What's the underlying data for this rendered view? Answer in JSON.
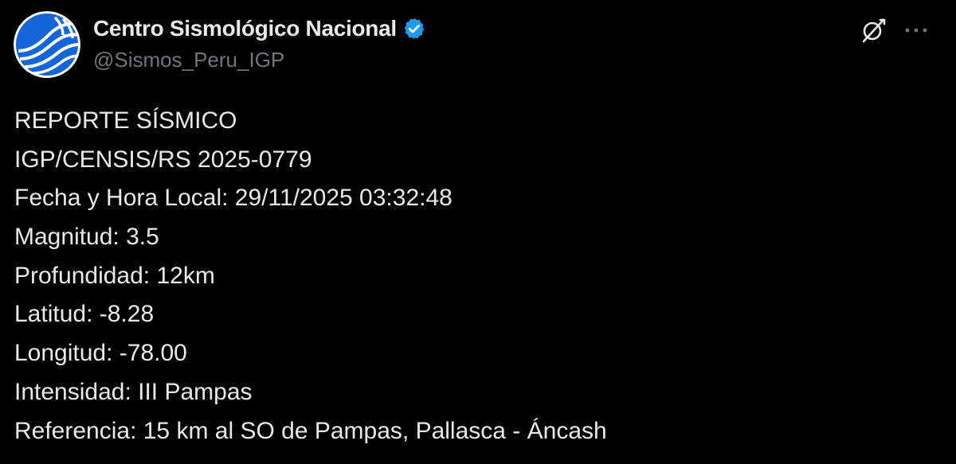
{
  "colors": {
    "background": "#000000",
    "primary_text": "#e7e9ea",
    "secondary_text": "#71767b",
    "verified_badge": "#1d9bf0",
    "avatar_blue": "#1565d8"
  },
  "author": {
    "display_name": "Centro Sismológico Nacional",
    "handle": "@Sismos_Peru_IGP",
    "verified": true,
    "avatar_icon": "igp-logo-icon"
  },
  "actions": {
    "grok_icon": "grok-slash-icon",
    "more_icon": "more-dots-icon",
    "more_label": "···"
  },
  "post": {
    "lines": [
      "REPORTE SÍSMICO",
      "IGP/CENSIS/RS 2025-0779",
      "Fecha y Hora Local: 29/11/2025 03:32:48",
      "Magnitud: 3.5",
      "Profundidad: 12km",
      "Latitud: -8.28",
      "Longitud: -78.00",
      "Intensidad: III Pampas",
      "Referencia: 15 km al SO de Pampas, Pallasca - Áncash"
    ]
  }
}
